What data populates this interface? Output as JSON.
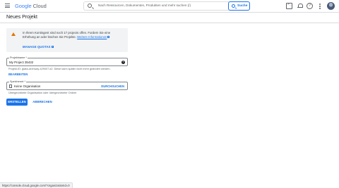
{
  "header": {
    "logo_word": "Google",
    "logo_product": "Cloud",
    "search_placeholder": "Nach Ressourcen, Dokumenten, Produkten und mehr suchen (/)",
    "search_button": "Suche"
  },
  "page": {
    "title": "Neues Projekt"
  },
  "alert": {
    "text": "In Ihrem Kontingent sind noch 17 projects offen. Fordern Sie eine Erhöhung an oder löschen Sie Projekte.",
    "link": "Weitere Informationen",
    "action": "MANAGE QUOTAS"
  },
  "form": {
    "project_name_label": "Projektname *",
    "project_name_value": "My Project 35432",
    "project_id_hint": "Projekt-ID: glass-archway-429007-k2. Diese kann später nicht mehr geändert werden.",
    "edit_label": "BEARBEITEN",
    "location_label": "Speicherort *",
    "location_value": "Keine Organisation",
    "browse_label": "DURCHSUCHEN",
    "location_hint": "Übergeordnete Organisation oder übergeordneter Ordner"
  },
  "actions": {
    "create": "ERSTELLEN",
    "cancel": "ABBRECHEN"
  },
  "status_bar": {
    "url": "https://console.cloud.google.com/?organizationId=0"
  },
  "icons": {
    "menu": "hamburger-icon",
    "search": "search-icon",
    "terminal": "terminal-icon",
    "notifications": "bell-icon",
    "help": "help-icon",
    "more": "more-vert-icon",
    "warning": "warning-icon",
    "organization": "organization-icon"
  },
  "colors": {
    "accent": "#1a73e8",
    "warning": "#e37400",
    "alert_bg": "#f1f3f4"
  }
}
